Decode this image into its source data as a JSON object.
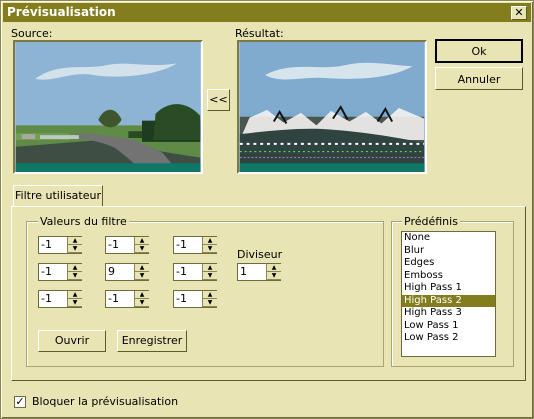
{
  "window": {
    "title": "Prévisualisation",
    "close_symbol": "✕"
  },
  "preview": {
    "source_label": "Source:",
    "result_label": "Résultat:",
    "copy_button": "<<"
  },
  "buttons": {
    "ok": "Ok",
    "cancel": "Annuler",
    "open": "Ouvrir",
    "save": "Enregistrer"
  },
  "tab": {
    "label": "Filtre utilisateur"
  },
  "filter": {
    "group_label": "Valeurs du filtre",
    "values": [
      "-1",
      "-1",
      "-1",
      "-1",
      "9",
      "-1",
      "-1",
      "-1",
      "-1"
    ],
    "divisor_label": "Diviseur",
    "divisor": "1"
  },
  "presets": {
    "label": "Prédéfinis",
    "items": [
      "None",
      "Blur",
      "Edges",
      "Emboss",
      "High Pass 1",
      "High Pass 2",
      "High Pass 3",
      "Low Pass 1",
      "Low Pass 2"
    ],
    "selected_index": 5
  },
  "footer": {
    "lock_preview_label": "Bloquer la prévisualisation",
    "lock_checked": true
  },
  "colors": {
    "title": "#837d1d",
    "window_bg": "#e8e4b4",
    "selection": "#837d1d"
  }
}
